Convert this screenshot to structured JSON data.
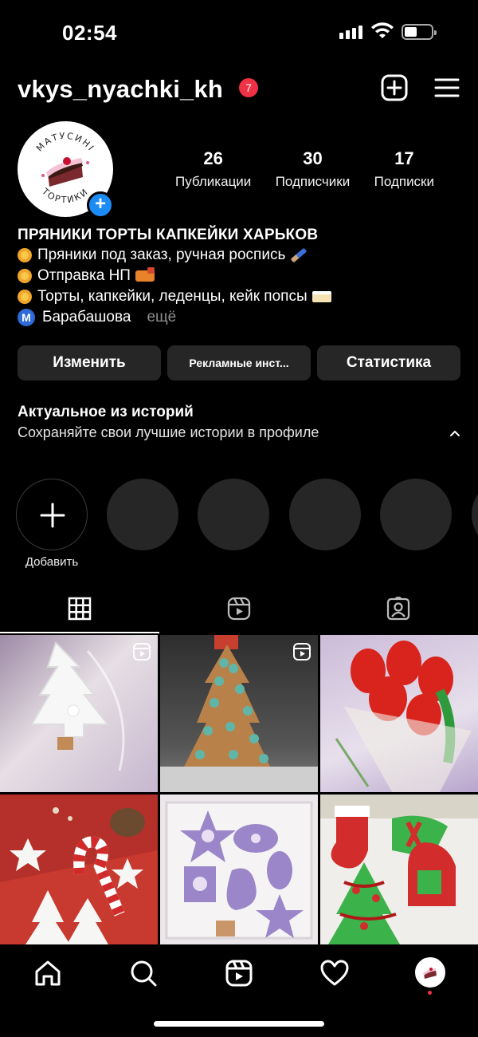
{
  "status_bar": {
    "time": "02:54"
  },
  "header": {
    "username": "vkys_nyachki_kh",
    "notification_count": "7",
    "icons": [
      "add-post-icon",
      "hamburger-menu-icon"
    ]
  },
  "profile": {
    "avatar_text_top": "МАТУСИНІ",
    "avatar_text_bottom": "ТОРТИКИ",
    "stats": [
      {
        "value": "26",
        "label": "Публикации"
      },
      {
        "value": "30",
        "label": "Подписчики"
      },
      {
        "value": "17",
        "label": "Подписки"
      }
    ],
    "bio": {
      "name": "ПРЯНИКИ ТОРТЫ КАПКЕЙКИ ХАРЬКОВ",
      "lines": [
        "Пряники под заказ, ручная роспись",
        "Отправка НП",
        "Торты, капкейки, леденцы, кейк попсы"
      ],
      "metro_letter": "М",
      "location": "Барабашова",
      "more": "ещё"
    }
  },
  "actions": {
    "edit": "Изменить",
    "ads": "Рекламные инст...",
    "stats": "Статистика"
  },
  "highlights": {
    "title": "Актуальное из историй",
    "subtitle": "Сохраняйте свои лучшие истории в профиле",
    "add_label": "Добавить"
  },
  "tabs": [
    {
      "name": "grid-icon",
      "active": true
    },
    {
      "name": "reels-icon",
      "active": false
    },
    {
      "name": "tagged-icon",
      "active": false
    }
  ],
  "posts": [
    {
      "subject": "white gingerbread tree in bag",
      "is_reel": true,
      "colors": [
        "#c9b8d6",
        "#f4f0ee"
      ]
    },
    {
      "subject": "gingerbread star tree",
      "is_reel": true,
      "colors": [
        "#3b3b3b",
        "#4fa39a"
      ]
    },
    {
      "subject": "red tulip cookie bouquet",
      "is_reel": false,
      "colors": [
        "#c4b1d4",
        "#d8241c"
      ]
    },
    {
      "subject": "christmas cookies on red",
      "is_reel": false,
      "colors": [
        "#c93a34",
        "#f6f6f4"
      ]
    },
    {
      "subject": "purple winter cookies box",
      "is_reel": false,
      "colors": [
        "#e8e3e8",
        "#9a86c8"
      ]
    },
    {
      "subject": "red green christmas cookies",
      "is_reel": false,
      "colors": [
        "#d22c2c",
        "#3bb34a"
      ]
    }
  ],
  "bottom_nav": [
    "home-icon",
    "search-icon",
    "reels-icon",
    "heart-icon",
    "profile-avatar"
  ]
}
